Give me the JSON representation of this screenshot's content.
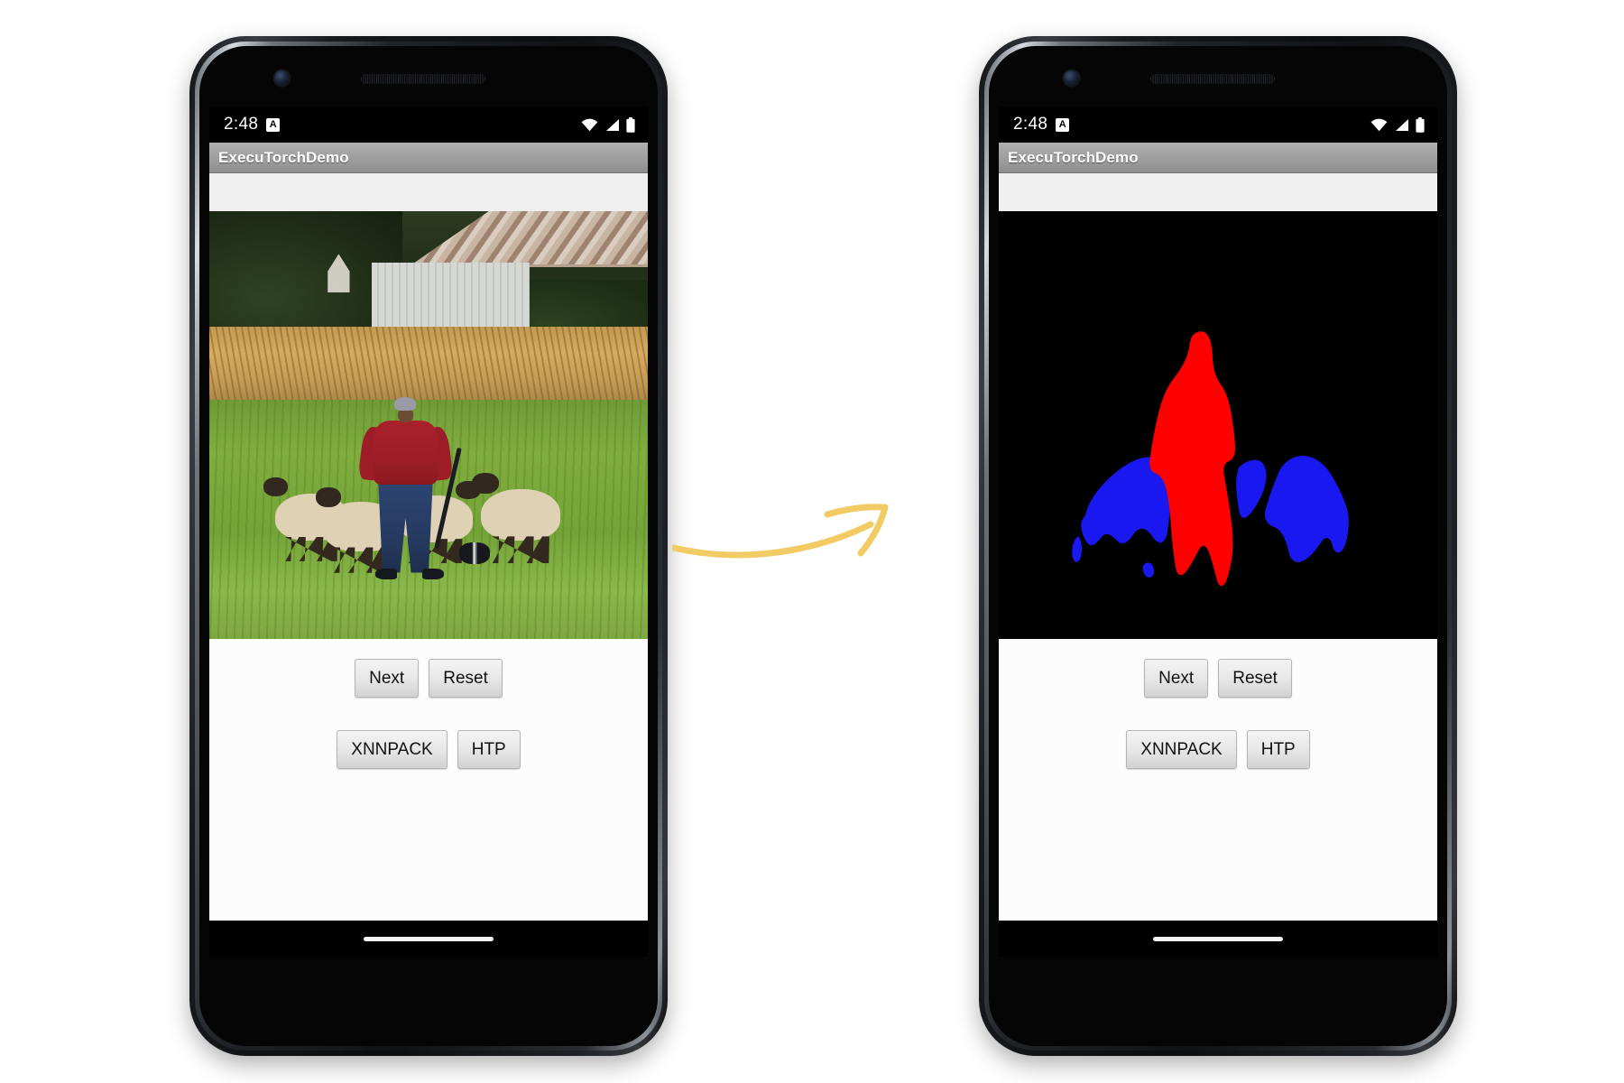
{
  "figure": {
    "type": "before-after-comparison",
    "arrow": {
      "name": "curved-arrow",
      "color": "#f3cb64",
      "direction": "left-to-right"
    },
    "background_color": "#ffffff"
  },
  "phones": [
    {
      "id": "phone-left",
      "role": "input",
      "status_bar": {
        "time": "2:48",
        "notification_badge": "A",
        "icons": [
          "wifi-icon",
          "cellular-signal-icon",
          "battery-icon"
        ]
      },
      "app_bar": {
        "title": "ExecuTorchDemo"
      },
      "image": {
        "name": "input-photo",
        "alt": "Shepherd in a red jacket standing in a green field with four sheep and a barn in the background",
        "kind": "photograph"
      },
      "buttons": {
        "row1": [
          "Next",
          "Reset"
        ],
        "row2": [
          "XNNPACK",
          "HTP"
        ]
      },
      "nav": {
        "pill": true
      }
    },
    {
      "id": "phone-right",
      "role": "output",
      "status_bar": {
        "time": "2:48",
        "notification_badge": "A",
        "icons": [
          "wifi-icon",
          "cellular-signal-icon",
          "battery-icon"
        ]
      },
      "app_bar": {
        "title": "ExecuTorchDemo"
      },
      "image": {
        "name": "segmentation-mask",
        "alt": "Semantic segmentation mask: red person silhouette in center, blue sheep shapes on both sides, black background",
        "kind": "segmentation-mask",
        "legend": [
          {
            "label": "person",
            "color": "#ff0000"
          },
          {
            "label": "sheep",
            "color": "#1a18f0"
          },
          {
            "label": "background",
            "color": "#000000"
          }
        ]
      },
      "buttons": {
        "row1": [
          "Next",
          "Reset"
        ],
        "row2": [
          "XNNPACK",
          "HTP"
        ]
      },
      "nav": {
        "pill": true
      }
    }
  ]
}
